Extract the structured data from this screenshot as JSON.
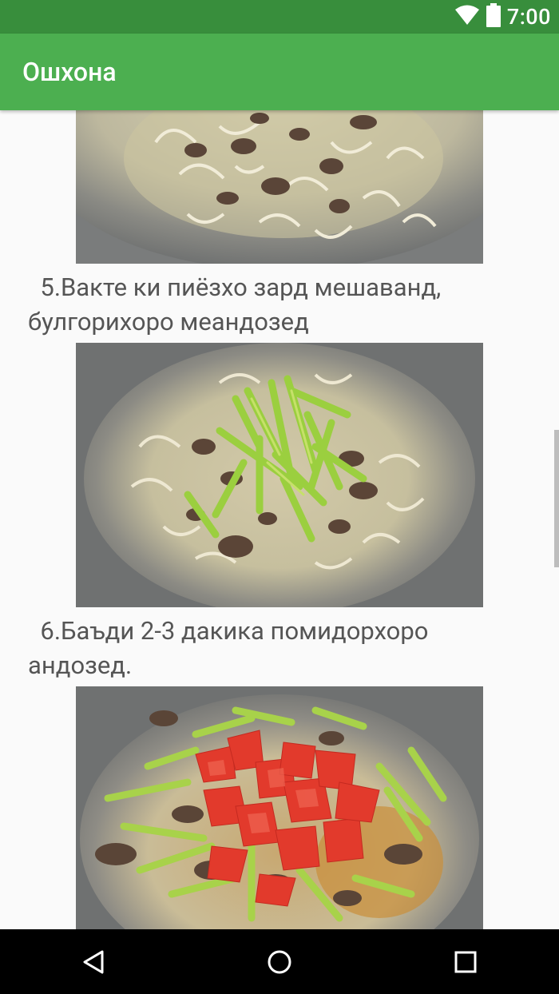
{
  "status_bar": {
    "time": "7:00",
    "icons": [
      "wifi-icon",
      "battery-icon"
    ]
  },
  "app_bar": {
    "title": "Ошхона"
  },
  "steps": [
    {
      "text": "  5.Вакте ки пиёзхо зард мешаванд, булгорихоро меандозед"
    },
    {
      "text": "  6.Баъди 2-3 дакика помидорхоро андозед."
    }
  ],
  "photos": [
    {
      "subject": "meat and onions in a kazan"
    },
    {
      "subject": "sliced green peppers added to the kazan"
    },
    {
      "subject": "chopped tomatoes added on top"
    }
  ],
  "nav_bar": {
    "icons": [
      "back-icon",
      "home-icon",
      "recents-icon"
    ]
  },
  "colors": {
    "status_bar": "#388e3c",
    "app_bar": "#4caf50",
    "text": "#555555"
  }
}
